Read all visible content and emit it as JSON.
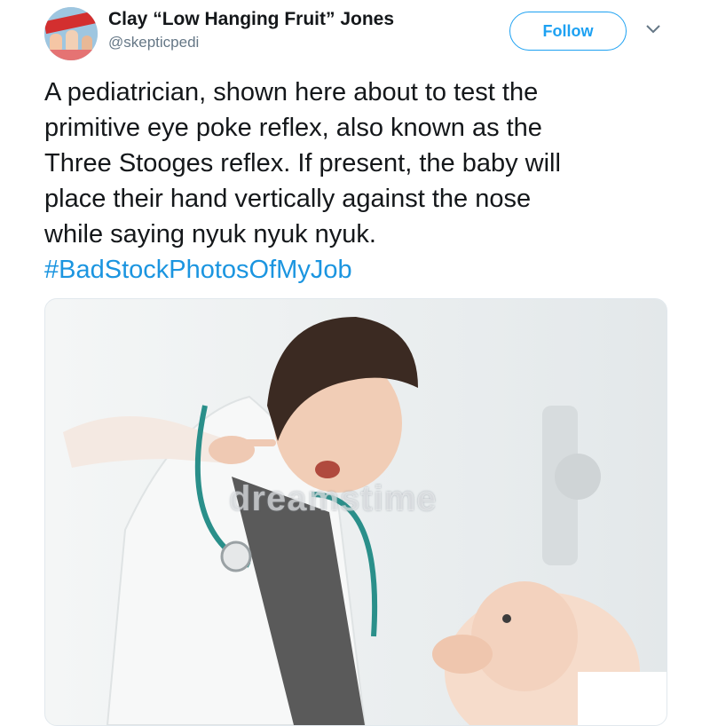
{
  "author": {
    "display_name": "Clay “Low Hanging Fruit” Jones",
    "handle": "@skepticpedi"
  },
  "actions": {
    "follow_label": "Follow"
  },
  "tweet": {
    "lines": [
      "A pediatrician, shown here about to test the",
      "primitive eye poke reflex, also known as the",
      "Three Stooges reflex. If present, the baby will",
      "place their hand vertically against the nose",
      "while saying nyuk nyuk nyuk."
    ],
    "hashtag": "#BadStockPhotosOfMyJob"
  },
  "media": {
    "watermark": "dreamstime"
  },
  "colors": {
    "accent": "#1da1f2",
    "hashtag": "#1b95e0",
    "text": "#14171a",
    "secondary": "#657786"
  },
  "icons": {
    "more": "chevron-down-icon"
  }
}
